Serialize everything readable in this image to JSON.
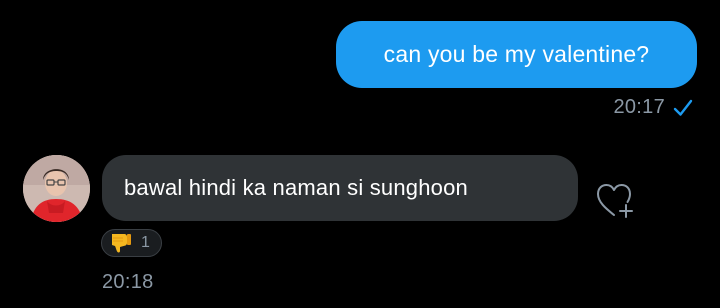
{
  "colors": {
    "background": "#000000",
    "outgoing_bubble": "#1d9bf0",
    "incoming_bubble": "#2f3336",
    "text_primary": "#ffffff",
    "text_secondary": "#8b98a5",
    "read_check": "#1d9bf0",
    "reaction_border": "#3a3f44",
    "reaction_fill": "#1a1d20"
  },
  "messages": {
    "outgoing": {
      "text": "can you be my valentine?",
      "time": "20:17",
      "status_icon": "check-icon"
    },
    "incoming": {
      "text": "bawal hindi ka naman si sunghoon",
      "time": "20:18",
      "avatar_icon": "avatar",
      "add_reaction_icon": "add-reaction-heart-icon",
      "reaction": {
        "emoji": "👎",
        "count": "1"
      }
    }
  }
}
